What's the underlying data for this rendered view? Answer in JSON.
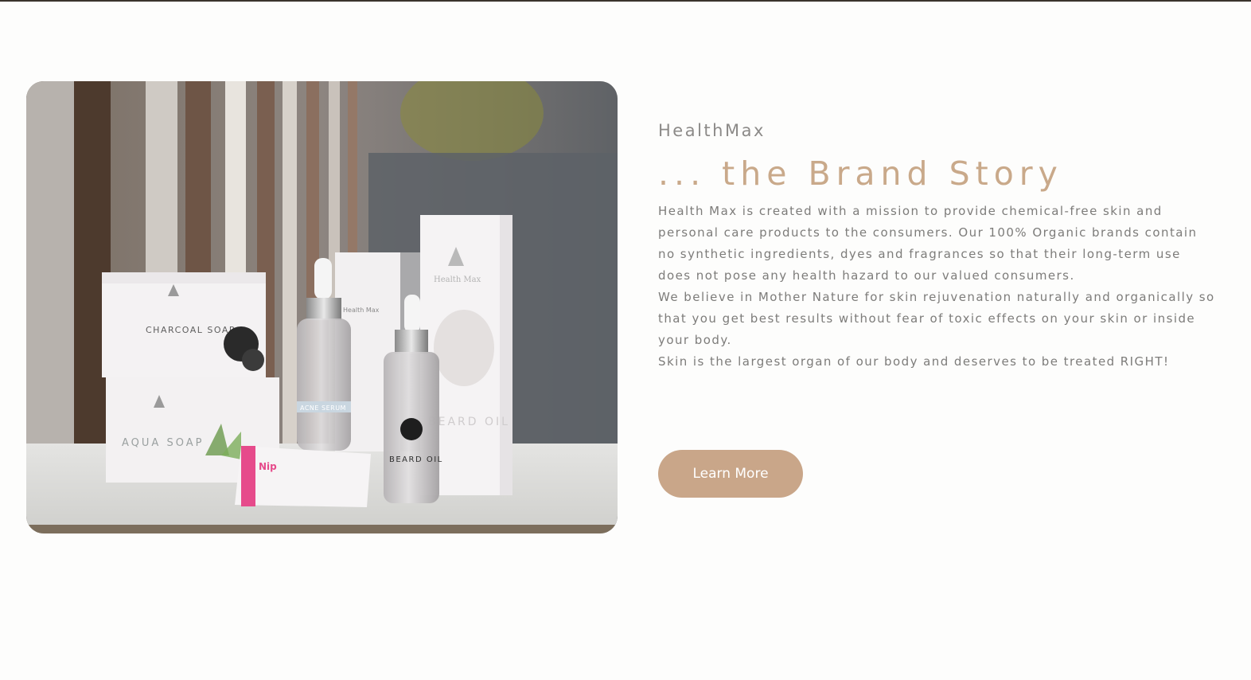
{
  "brand": {
    "eyebrow": "HealthMax",
    "headline": "... the Brand Story"
  },
  "story": {
    "paragraphs": [
      "Health Max is created with a mission to provide chemical-free skin and personal care products to the consumers. Our 100% Organic brands contain no synthetic ingredients, dyes and fragrances so that their long-term use does not pose any health hazard to our valued consumers.",
      "We believe in Mother Nature for skin rejuvenation naturally and organically so that you get best results without fear of toxic effects on your skin or inside your body.",
      "Skin is the largest organ of our body and deserves to be treated RIGHT!"
    ]
  },
  "cta": {
    "label": "Learn More"
  },
  "image": {
    "product_labels": {
      "charcoal_soap": "CHARCOAL SOAP",
      "aqua_soap": "AQUA SOAP",
      "acne_serum": "ACNE SERUM",
      "beard_oil_box": "BEARD OIL",
      "beard_oil_bottle": "BEARD OIL",
      "nip_tube": "Nip",
      "box_brand": "Health Max"
    }
  },
  "colors": {
    "accent": "#c9a98a",
    "button": "#c9a689",
    "body_text": "#7d7c7a",
    "eyebrow_text": "#8c8a88",
    "top_rule": "#3a342c"
  }
}
